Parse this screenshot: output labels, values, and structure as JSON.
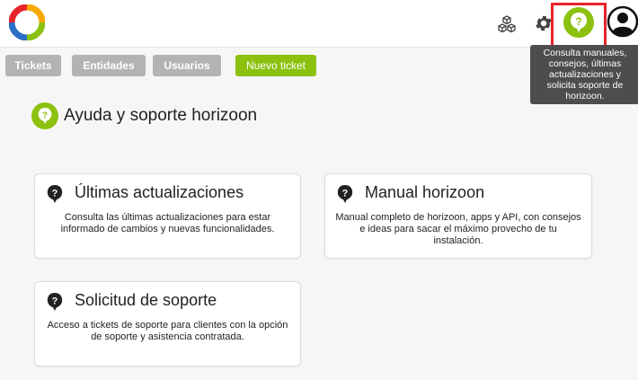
{
  "colors": {
    "accent": "#8cc10f",
    "tab_gray": "#b3b3b3",
    "highlight": "#e8232a",
    "tooltip_bg": "#4d4d4d"
  },
  "header": {
    "icons": [
      "horizoon-logo",
      "cubes-icon",
      "gear-icon",
      "help-icon",
      "user-avatar-icon"
    ],
    "tooltip_lines": [
      "Consulta manuales,",
      "consejos, últimas",
      "actualizaciones y",
      "solicita soporte de",
      "horizoon."
    ]
  },
  "tabs": [
    {
      "label": "Tickets"
    },
    {
      "label": "Entidades"
    },
    {
      "label": "Usuarios"
    },
    {
      "label": "Nuevo ticket"
    }
  ],
  "page": {
    "title": "Ayuda y soporte horizoon"
  },
  "cards": [
    {
      "title": "Últimas actualizaciones",
      "description": "Consulta las últimas actualizaciones para estar informado de cambios y nuevas funcionalidades."
    },
    {
      "title": "Manual horizoon",
      "description": "Manual completo de horizoon, apps y API, con consejos e ideas para sacar el máximo provecho de tu instalación."
    },
    {
      "title": "Solicitud de soporte",
      "description": "Acceso a tickets de soporte para clientes con la opción de soporte y asistencia contratada."
    }
  ]
}
